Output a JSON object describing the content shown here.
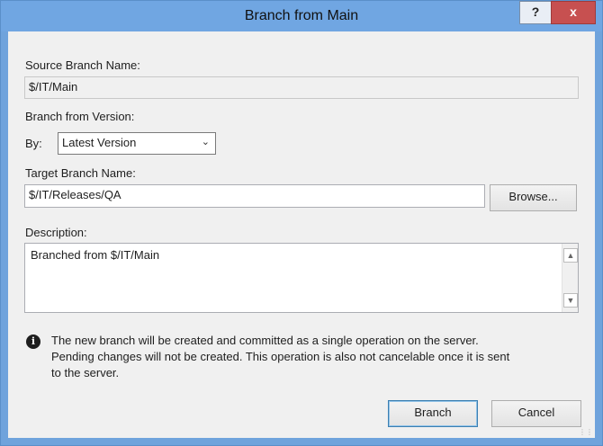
{
  "window": {
    "title": "Branch from Main"
  },
  "titlebar": {
    "help_label": "?",
    "close_label": "x"
  },
  "source": {
    "label": "Source Branch Name:",
    "value": "$/IT/Main"
  },
  "version": {
    "label": "Branch from Version:",
    "by_label": "By:",
    "selected": "Latest Version"
  },
  "target": {
    "label": "Target Branch Name:",
    "value": "$/IT/Releases/QA",
    "browse_label": "Browse..."
  },
  "description": {
    "label": "Description:",
    "value": "Branched from $/IT/Main"
  },
  "info": {
    "icon": "info-icon",
    "line1": "The new branch will be created and committed as a single operation on the server.",
    "line2": "Pending changes will not be created. This operation is also not cancelable once it is sent",
    "line3": "to the server."
  },
  "buttons": {
    "branch_label": "Branch",
    "cancel_label": "Cancel"
  },
  "colors": {
    "titlebar": "#70a6e2",
    "close_button": "#c75050",
    "dialog_background": "#f0f0f0"
  }
}
